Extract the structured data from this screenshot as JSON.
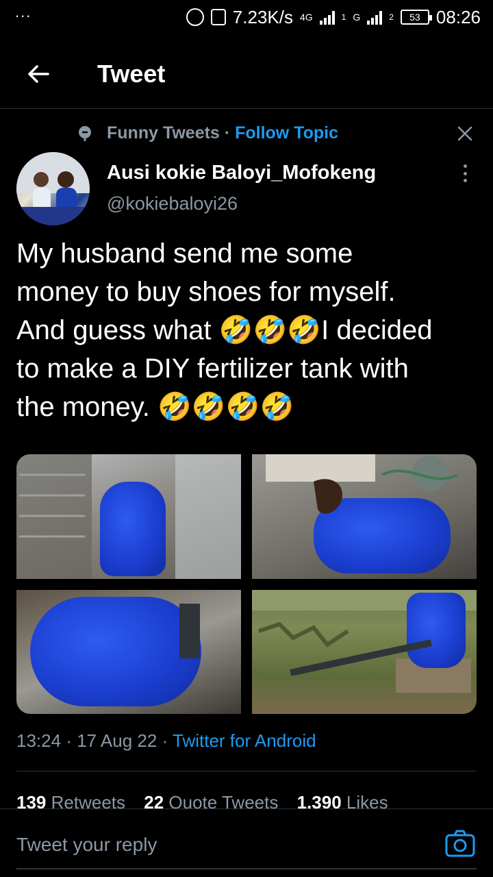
{
  "status_bar": {
    "dots": "...",
    "speed": "7.23K/s",
    "network1": "4G",
    "network2": "G",
    "sim1": "1",
    "sim2": "2",
    "battery": "53",
    "time": "08:26"
  },
  "header": {
    "title": "Tweet",
    "back_icon": "arrow-left-icon"
  },
  "topic": {
    "name": "Funny Tweets",
    "separator": "·",
    "follow_label": "Follow Topic",
    "icon": "topic-bubble-icon",
    "close_icon": "close-icon"
  },
  "author": {
    "name": "Ausi kokie Baloyi_Mofokeng",
    "handle": "@kokiebaloyi26",
    "more_icon": "more-vertical-icon"
  },
  "tweet": {
    "lines": [
      "My husband send me some",
      "money to buy shoes for myself.",
      "And guess what 🤣🤣🤣I decided",
      "to make a DIY fertilizer tank with",
      "the money. 🤣🤣🤣🤣"
    ],
    "media": [
      {
        "label": "Jojo"
      },
      {
        "label": "Jojo"
      },
      {
        "label": "Jojo"
      },
      {
        "label": "Jojo"
      }
    ]
  },
  "meta": {
    "time": "13:24",
    "date": "17 Aug 22",
    "separator": "·",
    "source": "Twitter for Android"
  },
  "stats": {
    "retweets_count": "139",
    "retweets_label": "Retweets",
    "quotes_count": "22",
    "quotes_label": "Quote Tweets",
    "likes_count": "1,390",
    "likes_label": "Likes"
  },
  "reply": {
    "placeholder": "Tweet your reply",
    "camera_icon": "camera-icon"
  },
  "colors": {
    "background": "#000000",
    "accent": "#1d9bf0",
    "muted": "#8b98a5",
    "divider": "#2f3336"
  }
}
